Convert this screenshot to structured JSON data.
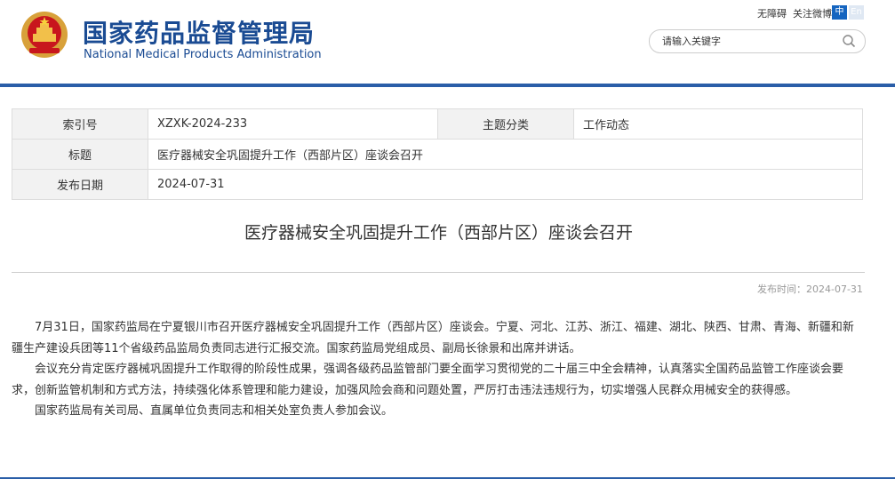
{
  "header": {
    "site_name_cn": "国家药品监督管理局",
    "site_name_en": "National Medical Products Administration",
    "accessibility_label": "无障碍",
    "weibo_label": "关注微博",
    "lang_cn": "中",
    "lang_en": "En",
    "search_placeholder": "请输入关键字",
    "brand_color": "#1a4b93",
    "accent_bar_color": "#2a5ea8"
  },
  "social_icons": [
    "weibo-icon",
    "wechat-icon",
    "mobile-icon",
    "mail-icon",
    "user-icon"
  ],
  "meta": {
    "index_label": "索引号",
    "index_value": "XZXK-2024-233",
    "topic_label": "主题分类",
    "topic_value": "工作动态",
    "title_label": "标题",
    "title_value": "医疗器械安全巩固提升工作（西部片区）座谈会召开",
    "date_label": "发布日期",
    "date_value": "2024-07-31"
  },
  "article": {
    "title": "医疗器械安全巩固提升工作（西部片区）座谈会召开",
    "publish_time": "发布时间：2024-07-31",
    "paragraphs": [
      "7月31日，国家药监局在宁夏银川市召开医疗器械安全巩固提升工作（西部片区）座谈会。宁夏、河北、江苏、浙江、福建、湖北、陕西、甘肃、青海、新疆和新疆生产建设兵团等11个省级药品监局负责同志进行汇报交流。国家药监局党组成员、副局长徐景和出席并讲话。",
      "会议充分肯定医疗器械巩固提升工作取得的阶段性成果，强调各级药品监管部门要全面学习贯彻党的二十届三中全会精神，认真落实全国药品监管工作座谈会要求，创新监管机制和方式方法，持续强化体系管理和能力建设，加强风险会商和问题处置，严厉打击违法违规行为，切实增强人民群众用械安全的获得感。",
      "国家药监局有关司局、直属单位负责同志和相关处室负责人参加会议。"
    ]
  },
  "tools": [
    "download-icon",
    "print-icon"
  ],
  "share": [
    "share-weibo-icon",
    "share-qzone-icon",
    "share-wechat-icon"
  ]
}
